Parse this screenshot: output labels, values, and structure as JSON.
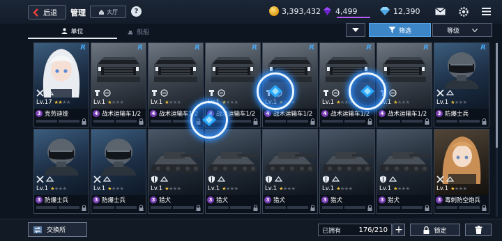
{
  "header": {
    "back_label": "后退",
    "title": "管理",
    "lobby_label": "大厅",
    "help_label": "?",
    "resources": {
      "credits": "3,393,432",
      "gems": "4,499",
      "crystals": "12,390"
    },
    "icons": [
      "mail-icon",
      "settings-icon",
      "menu-icon"
    ]
  },
  "tabs": [
    {
      "label": "单位",
      "icon": "person-icon",
      "active": true
    },
    {
      "label": "舰船",
      "icon": "ship-icon",
      "active": false
    }
  ],
  "controls": {
    "filter_label": "筛选",
    "sort_label": "等级"
  },
  "cards": [
    {
      "rank": "R",
      "level": "Lv.17",
      "stars": 2,
      "cost": "3",
      "name": "克劳迪娅",
      "type": "girl-white"
    },
    {
      "rank": "R",
      "level": "Lv.1",
      "stars": 1,
      "cost": "4",
      "name": "战术运输车1/2",
      "type": "vehicle"
    },
    {
      "rank": "R",
      "level": "Lv.1",
      "stars": 1,
      "cost": "4",
      "name": "战术运输车1/2",
      "type": "vehicle"
    },
    {
      "rank": "R",
      "level": "Lv.1",
      "stars": 1,
      "cost": "4",
      "name": "战术运输车1/2",
      "type": "vehicle"
    },
    {
      "rank": "R",
      "level": "Lv.1",
      "stars": 1,
      "cost": "4",
      "name": "战术运输车1/2",
      "type": "vehicle"
    },
    {
      "rank": "R",
      "level": "Lv.1",
      "stars": 1,
      "cost": "4",
      "name": "战术运输车1/2",
      "type": "vehicle"
    },
    {
      "rank": "R",
      "level": "Lv.1",
      "stars": 1,
      "cost": "4",
      "name": "战术运输车1/2",
      "type": "vehicle"
    },
    {
      "rank": "R",
      "level": "Lv.1",
      "stars": 1,
      "cost": "3",
      "name": "防爆士兵",
      "type": "soldier"
    },
    {
      "rank": "",
      "level": "Lv.1",
      "stars": 1,
      "cost": "3",
      "name": "防爆士兵",
      "type": "soldier"
    },
    {
      "rank": "",
      "level": "Lv.1",
      "stars": 1,
      "cost": "3",
      "name": "防爆士兵",
      "type": "soldier"
    },
    {
      "rank": "",
      "level": "Lv.1",
      "stars": 1,
      "cost": "3",
      "name": "猎犬",
      "type": "tank"
    },
    {
      "rank": "",
      "level": "Lv.1",
      "stars": 1,
      "cost": "3",
      "name": "猎犬",
      "type": "tank"
    },
    {
      "rank": "",
      "level": "Lv.1",
      "stars": 1,
      "cost": "3",
      "name": "猎犬",
      "type": "tank"
    },
    {
      "rank": "",
      "level": "Lv.1",
      "stars": 1,
      "cost": "3",
      "name": "猎犬",
      "type": "tank"
    },
    {
      "rank": "",
      "level": "Lv.1",
      "stars": 1,
      "cost": "3",
      "name": "猎犬",
      "type": "tank"
    },
    {
      "rank": "",
      "level": "Lv.1",
      "stars": 1,
      "cost": "3",
      "name": "毒刺防空炮兵",
      "type": "girl-brown"
    }
  ],
  "footer": {
    "exchange_label": "交换所",
    "owned_label": "已拥有",
    "owned_count": "176/210",
    "plus_label": "+",
    "lock_label": "锁定"
  }
}
